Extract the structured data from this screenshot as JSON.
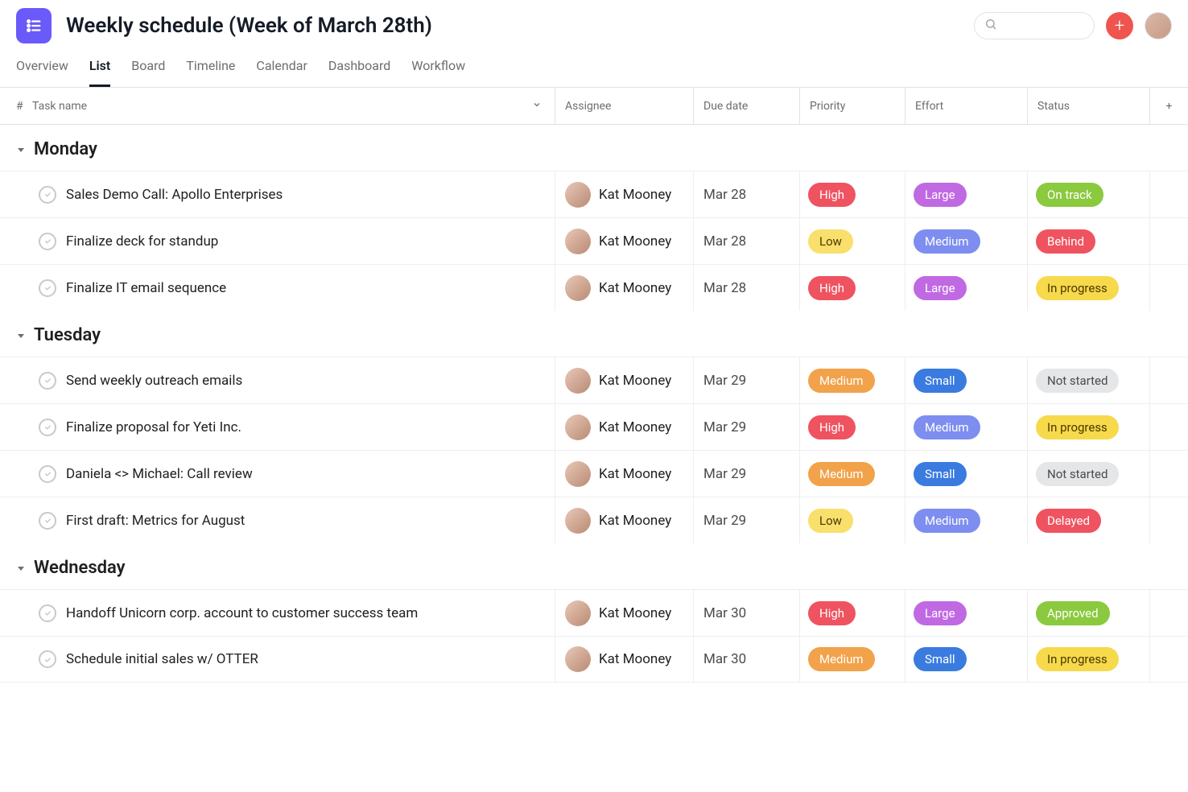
{
  "header": {
    "title": "Weekly schedule (Week of March 28th)"
  },
  "search": {
    "placeholder": ""
  },
  "tabs": [
    {
      "label": "Overview",
      "active": false
    },
    {
      "label": "List",
      "active": true
    },
    {
      "label": "Board",
      "active": false
    },
    {
      "label": "Timeline",
      "active": false
    },
    {
      "label": "Calendar",
      "active": false
    },
    {
      "label": "Dashboard",
      "active": false
    },
    {
      "label": "Workflow",
      "active": false
    }
  ],
  "columns": {
    "num": "#",
    "task": "Task name",
    "assignee": "Assignee",
    "due": "Due date",
    "priority": "Priority",
    "effort": "Effort",
    "status": "Status"
  },
  "sections": [
    {
      "title": "Monday",
      "rows": [
        {
          "task": "Sales Demo Call: Apollo Enterprises",
          "assignee": "Kat Mooney",
          "due": "Mar 28",
          "priority": "High",
          "priority_class": "high",
          "effort": "Large",
          "effort_class": "large",
          "status": "On track",
          "status_class": "ontrack"
        },
        {
          "task": "Finalize deck for standup",
          "assignee": "Kat Mooney",
          "due": "Mar 28",
          "priority": "Low",
          "priority_class": "low",
          "effort": "Medium",
          "effort_class": "medium-e",
          "status": "Behind",
          "status_class": "behind"
        },
        {
          "task": "Finalize IT email sequence",
          "assignee": "Kat Mooney",
          "due": "Mar 28",
          "priority": "High",
          "priority_class": "high",
          "effort": "Large",
          "effort_class": "large",
          "status": "In progress",
          "status_class": "inprogress"
        }
      ]
    },
    {
      "title": "Tuesday",
      "rows": [
        {
          "task": "Send weekly outreach emails",
          "assignee": "Kat Mooney",
          "due": "Mar 29",
          "priority": "Medium",
          "priority_class": "medium-p",
          "effort": "Small",
          "effort_class": "small",
          "status": "Not started",
          "status_class": "notstarted"
        },
        {
          "task": "Finalize proposal for Yeti Inc.",
          "assignee": "Kat Mooney",
          "due": "Mar 29",
          "priority": "High",
          "priority_class": "high",
          "effort": "Medium",
          "effort_class": "medium-e",
          "status": "In progress",
          "status_class": "inprogress"
        },
        {
          "task": "Daniela <> Michael: Call review",
          "assignee": "Kat Mooney",
          "due": "Mar 29",
          "priority": "Medium",
          "priority_class": "medium-p",
          "effort": "Small",
          "effort_class": "small",
          "status": "Not started",
          "status_class": "notstarted"
        },
        {
          "task": "First draft: Metrics for August",
          "assignee": "Kat Mooney",
          "due": "Mar 29",
          "priority": "Low",
          "priority_class": "low",
          "effort": "Medium",
          "effort_class": "medium-e",
          "status": "Delayed",
          "status_class": "delayed"
        }
      ]
    },
    {
      "title": "Wednesday",
      "rows": [
        {
          "task": "Handoff Unicorn corp. account to customer success team",
          "assignee": "Kat Mooney",
          "due": "Mar 30",
          "priority": "High",
          "priority_class": "high",
          "effort": "Large",
          "effort_class": "large",
          "status": "Approved",
          "status_class": "approved"
        },
        {
          "task": "Schedule initial sales w/ OTTER",
          "assignee": "Kat Mooney",
          "due": "Mar 30",
          "priority": "Medium",
          "priority_class": "medium-p",
          "effort": "Small",
          "effort_class": "small",
          "status": "In progress",
          "status_class": "inprogress"
        }
      ]
    }
  ]
}
